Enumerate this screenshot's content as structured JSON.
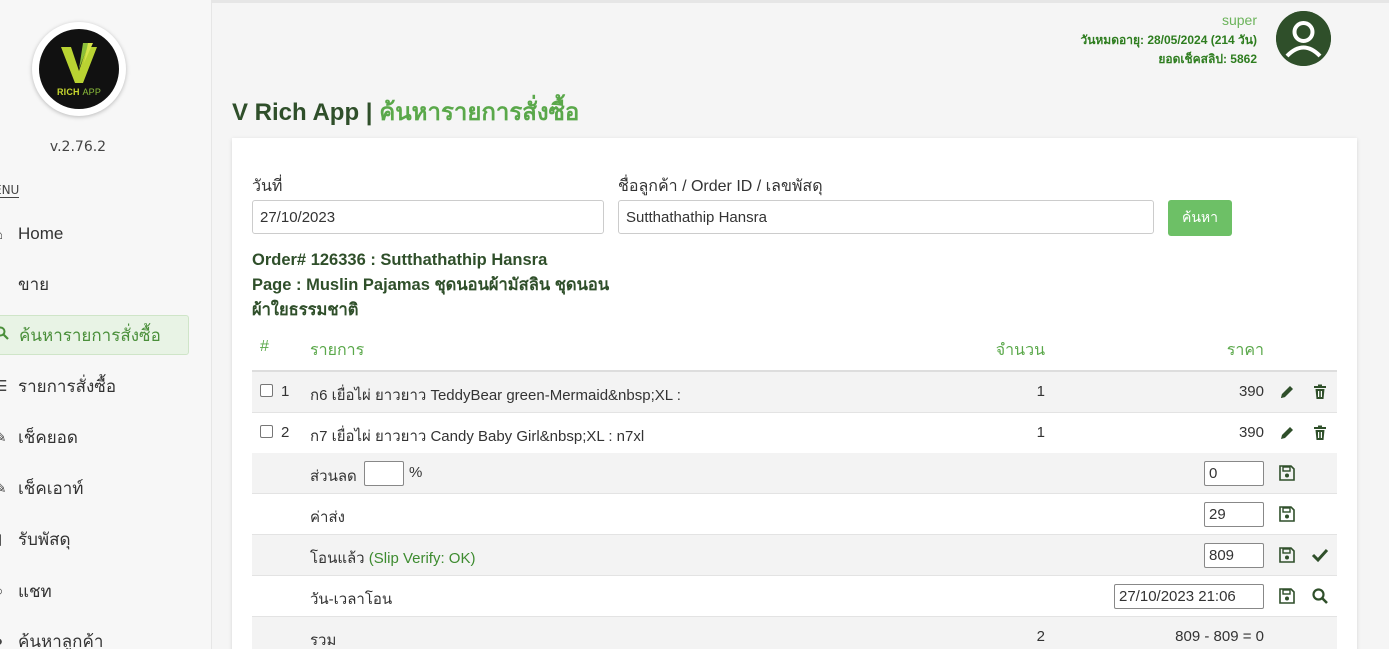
{
  "sidebar": {
    "logo_text_main": "RICH",
    "logo_text_app": "APP",
    "version": "v.2.76.2",
    "menu_label": "ENU",
    "items": [
      {
        "label": "Home",
        "icon": "home-icon"
      },
      {
        "label": "ขาย",
        "icon": "cart-icon"
      },
      {
        "label": "ค้นหารายการสั่งซื้อ",
        "icon": "search-icon"
      },
      {
        "label": "รายการสั่งซื้อ",
        "icon": "list-icon"
      },
      {
        "label": "เช็คยอด",
        "icon": "pencil-icon"
      },
      {
        "label": "เช็คเอาท์",
        "icon": "edit-icon"
      },
      {
        "label": "รับพัสดุ",
        "icon": "box-icon"
      },
      {
        "label": "แชท",
        "icon": "chat-icon"
      },
      {
        "label": "ค้นหาลูกค้า",
        "icon": "user-icon"
      }
    ]
  },
  "header": {
    "user_name": "super",
    "expire": "วันหมดอายุ: 28/05/2024 (214 วัน)",
    "slip_balance": "ยอดเช็คสลิป: 5862",
    "app_name": "V Rich App",
    "separator": " | ",
    "page_title": "ค้นหารายการสั่งซื้อ"
  },
  "search": {
    "date_label": "วันที่",
    "date_value": "27/10/2023",
    "query_label": "ชื่อลูกค้า / Order ID / เลขพัสดุ",
    "query_value": "Sutthathathip Hansra",
    "button_label": "ค้นหา"
  },
  "order": {
    "heading": "Order# 126336 : Sutthathathip Hansra",
    "page_line1": "Page : Muslin Pajamas ชุดนอนผ้ามัสลิน ชุดนอน",
    "page_line2": "ผ้าใยธรรมชาติ"
  },
  "table": {
    "headers": {
      "num": "#",
      "item": "รายการ",
      "qty": "จำนวน",
      "price": "ราคา"
    },
    "items": [
      {
        "num": "1",
        "name": "ก6 เยื่อไผ่ ยาวยาว TeddyBear green-Mermaid&nbsp;XL :",
        "qty": "1",
        "price": "390"
      },
      {
        "num": "2",
        "name": "ก7 เยื่อไผ่ ยาวยาว Candy Baby Girl&nbsp;XL : n7xl",
        "qty": "1",
        "price": "390"
      }
    ],
    "discount_label": "ส่วนลด",
    "discount_percent_value": "",
    "percent_sign": "%",
    "discount_value": "0",
    "shipping_label": "ค่าส่ง",
    "shipping_value": "29",
    "paid_label": "โอนแล้ว",
    "paid_status": "(Slip Verify: OK)",
    "paid_value": "809",
    "transfer_time_label": "วัน-เวลาโอน",
    "transfer_time_value": "27/10/2023 21:06",
    "total_label": "รวม",
    "total_qty": "2",
    "total_calc": "809 - 809 = 0"
  },
  "colors": {
    "brand_green": "#5aa84a",
    "dark_green": "#2f4f2a",
    "button_green": "#6dc066"
  }
}
